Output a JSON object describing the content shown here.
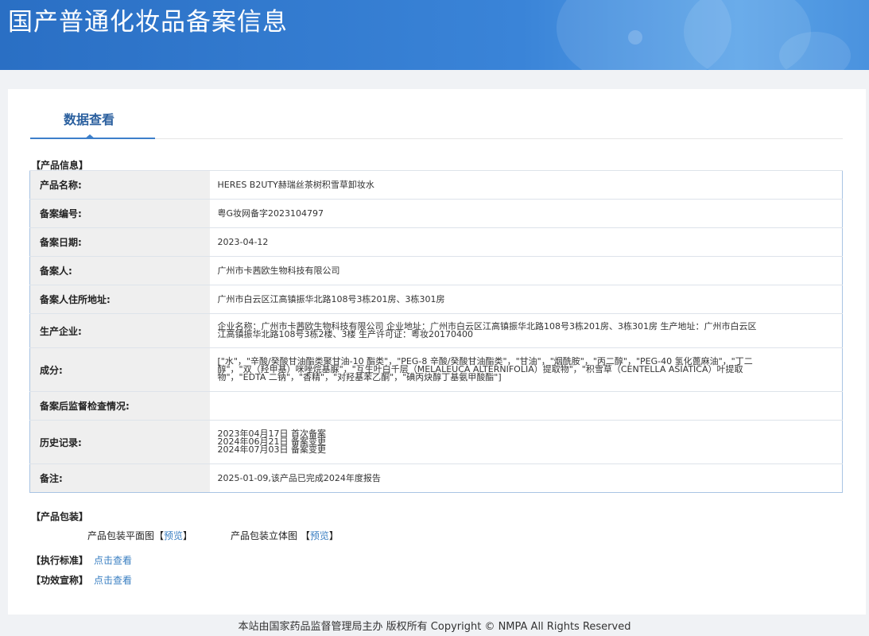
{
  "header": {
    "title": "国产普通化妆品备案信息"
  },
  "tab": {
    "label": "数据查看"
  },
  "product_info": {
    "section_title": "【产品信息】",
    "rows": [
      {
        "key": "产品名称:",
        "value": [
          "HERES B2UTY赫瑞丝茶树积雪草卸妆水"
        ]
      },
      {
        "key": "备案编号:",
        "value": [
          "粤G妆网备字2023104797"
        ]
      },
      {
        "key": "备案日期:",
        "value": [
          "2023-04-12"
        ]
      },
      {
        "key": "备案人:",
        "value": [
          "广州市卡茜欧生物科技有限公司"
        ]
      },
      {
        "key": "备案人住所地址:",
        "value": [
          "广州市白云区江高镇振华北路108号3栋201房、3栋301房"
        ]
      },
      {
        "key": "生产企业:",
        "value": [
          "企业名称：广州市卡茜欧生物科技有限公司 企业地址：广州市白云区江高镇振华北路108号3栋201房、3栋301房 生产地址：广州市白云区",
          "江高镇振华北路108号3栋2楼、3楼 生产许可证：粤妆20170400"
        ]
      },
      {
        "key": "成分:",
        "value": [
          "[\"水\"，\"辛酸/癸酸甘油酯类聚甘油-10 酯类\"，\"PEG-8 辛酸/癸酸甘油酯类\"，\"甘油\"，\"烟酰胺\"，\"丙二醇\"，\"PEG-40 氢化蓖麻油\"，\"丁二",
          "醇\"，\"双（羟甲基）咪唑烷基脲\"，\"互生叶白千层（MELALEUCA ALTERNIFOLIA）提取物\"，\"积雪草（CENTELLA ASIATICA）叶提取",
          "物\"，\"EDTA 二钠\"，\"香精\"，\"对羟基苯乙酮\"，\"碘丙炔醇丁基氨甲酸酯\"]"
        ]
      },
      {
        "key": "备案后监督检查情况:",
        "value": [
          ""
        ]
      },
      {
        "key": "历史记录:",
        "value": [
          "2023年04月17日 首次备案",
          "2024年06月21日 备案变更",
          "2024年07月03日 备案变更"
        ]
      },
      {
        "key": "备注:",
        "value": [
          "2025-01-09,该产品已完成2024年度报告"
        ]
      }
    ]
  },
  "packaging": {
    "section_title": "【产品包装】",
    "flat_label": "产品包装平面图",
    "solid_label": "产品包装立体图",
    "preview_link": "预览",
    "bracket_open": "【",
    "bracket_close": "】"
  },
  "standard": {
    "section_title": "【执行标准】",
    "link": "点击查看"
  },
  "efficacy": {
    "section_title": "【功效宣称】",
    "link": "点击查看"
  },
  "footer": {
    "text": "本站由国家药品监督管理局主办 版权所有 Copyright © NMPA All Rights Reserved"
  },
  "colors": {
    "header_blue": "#2f78cc",
    "tab_accent": "#3d7fca",
    "link": "#3a7fc2",
    "label_bg": "#efefef"
  }
}
